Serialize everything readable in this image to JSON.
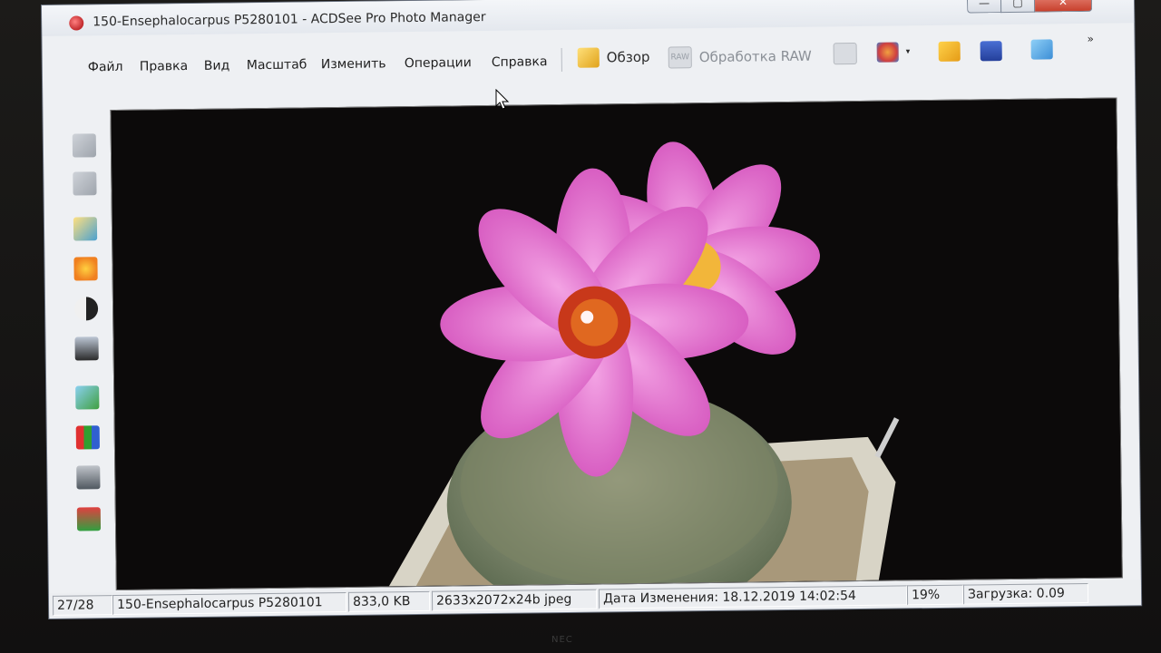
{
  "window": {
    "title": "150-Ensephalocarpus P5280101 - ACDSee Pro Photo Manager",
    "close_glyph": "✕",
    "maximize_glyph": "▢",
    "minimize_glyph": "—"
  },
  "menu": [
    "Файл",
    "Правка",
    "Вид",
    "Масштаб",
    "Изменить",
    "Операции",
    "Справка"
  ],
  "toolbar": {
    "browse_label": "Обзор",
    "raw_label": "Обработка RAW",
    "overflow_glyph": "»"
  },
  "status": {
    "position": "27/28",
    "filename": "150-Ensephalocarpus P5280101",
    "filesize": "833,0 KB",
    "dimensions": "2633x2072x24b jpeg",
    "modified": "Дата Изменения: 18.12.2019 14:02:54",
    "zoom": "19%",
    "load": "Загрузка: 0.09"
  },
  "left_toolbar_icons": [
    "rotate-left-icon",
    "rotate-right-icon",
    "photo-icon",
    "exposure-icon",
    "contrast-icon",
    "portrait-icon",
    "landscape-icon",
    "histogram-icon",
    "levels-icon",
    "color-icon"
  ],
  "colors": {
    "flower": "#e97bd0",
    "flower_center": "#c8381a",
    "background": "#0c0a0a"
  },
  "monitor_brand": "NEC"
}
